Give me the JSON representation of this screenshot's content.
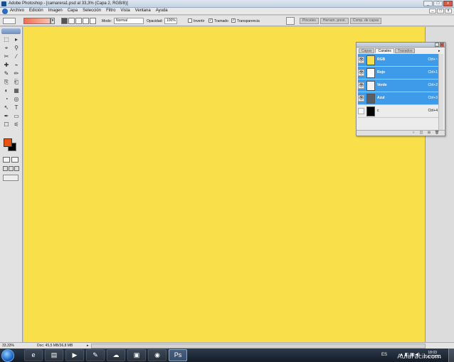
{
  "window": {
    "title": "Adobe Photoshop - [camarera1.psd al 33,3% (Capa 2, RGB/8)]",
    "minimize": "_",
    "maximize": "□",
    "close": "x"
  },
  "menu": {
    "items": [
      "Archivo",
      "Edición",
      "Imagen",
      "Capa",
      "Selección",
      "Filtro",
      "Vista",
      "Ventana",
      "Ayuda"
    ]
  },
  "options": {
    "mode_label": "Modo:",
    "mode_value": "Normal",
    "opacity_label": "Opacidad:",
    "opacity_value": "100%",
    "invert_label": "Invertir",
    "dither_label": "Tramado",
    "transparency_label": "Transparencia",
    "well_tabs": [
      "Pinceles",
      "Herram. prest.",
      "Comp. de capas"
    ],
    "gradient_color_start": "#f07050",
    "gradient_color_end": "#f9c0b0"
  },
  "toolbox": {
    "tools": [
      "⬚",
      "▸",
      "⌖",
      "⚲",
      "✂",
      "⁄",
      "✚",
      "⌁",
      "✎",
      "✏",
      "⎘",
      "⎗",
      "◐",
      "▦",
      "◔",
      "◎",
      "↖",
      "T",
      "✒",
      "▭",
      "☐",
      "⚟",
      "✋",
      "🔍"
    ],
    "foreground_color": "#e8530f",
    "background_color": "#000000"
  },
  "canvas": {
    "color": "#f9e04a"
  },
  "status": {
    "zoom": "33,33%",
    "doc_info": "Doc: 45,5 MB/36,8 MB",
    "arrow": "▸"
  },
  "channels_panel": {
    "tabs": [
      "Capas",
      "Canales",
      "Trazados"
    ],
    "active_tab": "Canales",
    "channels": [
      {
        "name": "RGB",
        "shortcut": "Ctrl+~",
        "thumb": "#f9e04a"
      },
      {
        "name": "Rojo",
        "shortcut": "Ctrl+1",
        "thumb": "#ffffff"
      },
      {
        "name": "Verde",
        "shortcut": "Ctrl+2",
        "thumb": "#f2f2f2"
      },
      {
        "name": "Azul",
        "shortcut": "Ctrl+3",
        "thumb": "#5a5f66"
      },
      {
        "name": "c",
        "shortcut": "Ctrl+4",
        "thumb": "#050505"
      }
    ],
    "menu_glyph": "▸",
    "footer_glyphs": [
      "○",
      "◫",
      "⊞",
      "🗑"
    ]
  },
  "taskbar": {
    "apps": [
      "e",
      "▤",
      "▶",
      "✎",
      "☁",
      "▣",
      "◉",
      "Ps"
    ],
    "language": "ES",
    "tray_icons": "▲ ◧ ▦ ◀)",
    "time": "18:03",
    "date": "25/07/2011"
  },
  "watermark": "AulaFacil.com"
}
